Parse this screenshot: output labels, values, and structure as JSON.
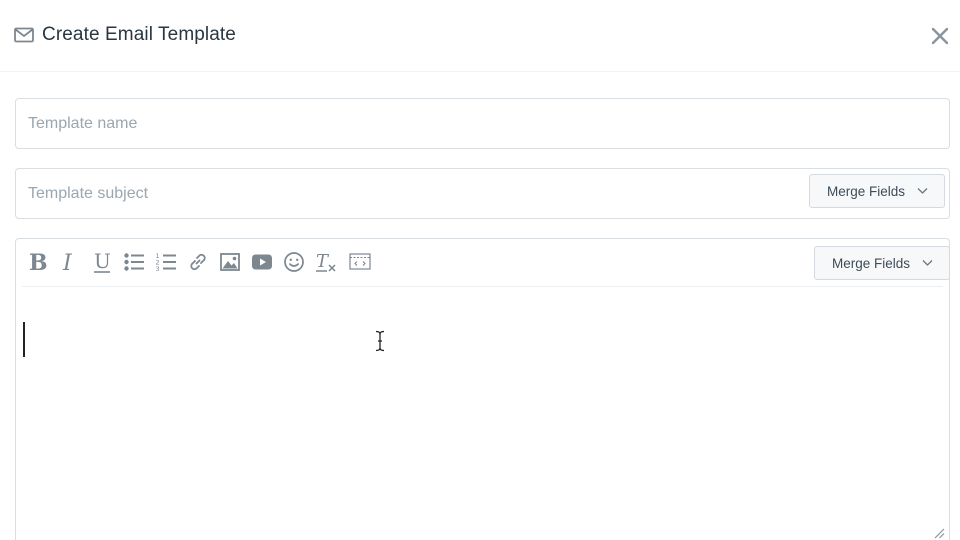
{
  "dialog": {
    "title": "Create Email Template",
    "title_icon": "mail-icon",
    "close_icon": "close-icon"
  },
  "form": {
    "name": {
      "value": "",
      "placeholder": "Template name"
    },
    "subject": {
      "value": "",
      "placeholder": "Template subject",
      "merge_label": "Merge Fields"
    }
  },
  "editor": {
    "merge_label": "Merge Fields",
    "content": "",
    "toolbar": [
      {
        "name": "bold",
        "icon": "bold-icon"
      },
      {
        "name": "italic",
        "icon": "italic-icon"
      },
      {
        "name": "underline",
        "icon": "underline-icon"
      },
      {
        "name": "bulleted-list",
        "icon": "bulleted-list-icon"
      },
      {
        "name": "numbered-list",
        "icon": "numbered-list-icon"
      },
      {
        "name": "link",
        "icon": "link-icon"
      },
      {
        "name": "image",
        "icon": "image-icon"
      },
      {
        "name": "video",
        "icon": "video-icon"
      },
      {
        "name": "emoji",
        "icon": "emoji-icon"
      },
      {
        "name": "clear-formatting",
        "icon": "clear-formatting-icon"
      },
      {
        "name": "html-source",
        "icon": "code-view-icon"
      }
    ]
  },
  "colors": {
    "border": "#d9dee3",
    "icon": "#7d8790",
    "placeholder": "#9aa6b0",
    "button_bg": "#f6f8f9"
  }
}
